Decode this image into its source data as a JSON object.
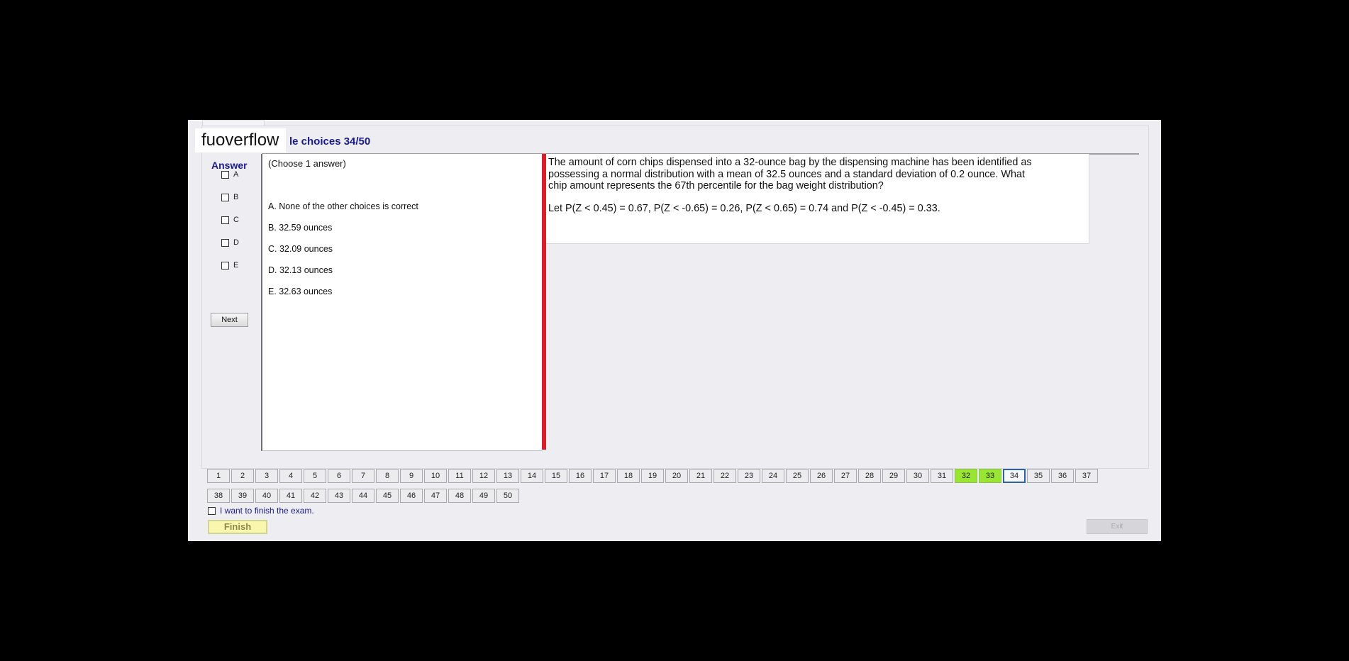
{
  "brand": "fuoverflow",
  "section_title": "le choices 34/50",
  "answer_heading": "Answer",
  "answer_options": [
    "A",
    "B",
    "C",
    "D",
    "E"
  ],
  "next_label": "Next",
  "choose_hint": "(Choose 1 answer)",
  "choices": [
    "A.  None of the other choices is correct",
    "B.  32.59 ounces",
    "C.  32.09 ounces",
    "D.  32.13 ounces",
    "E.  32.63 ounces"
  ],
  "question": {
    "text": "The amount of corn chips dispensed into a 32-ounce bag by the dispensing machine has been identified as possessing a normal distribution with a mean of 32.5 ounces and a standard deviation of 0.2 ounce. What chip amount represents the 67th percentile for the bag weight distribution?",
    "hint": "Let P(Z < 0.45) = 0.67, P(Z < -0.65) = 0.26, P(Z < 0.65) = 0.74 and P(Z < -0.45) = 0.33."
  },
  "question_nav": {
    "row1": [
      "1",
      "2",
      "3",
      "4",
      "5",
      "6",
      "7",
      "8",
      "9",
      "10",
      "11",
      "12",
      "13",
      "14",
      "15",
      "16",
      "17",
      "18",
      "19",
      "20",
      "21",
      "22",
      "23",
      "24",
      "25",
      "26",
      "27",
      "28",
      "29",
      "30",
      "31",
      "32",
      "33",
      "34",
      "35",
      "36",
      "37"
    ],
    "row2": [
      "38",
      "39",
      "40",
      "41",
      "42",
      "43",
      "44",
      "45",
      "46",
      "47",
      "48",
      "49",
      "50"
    ],
    "answered": [
      "32",
      "33"
    ],
    "current": "34",
    "answered_color": "#99e632",
    "current_border_color": "#2e62a8"
  },
  "finish_checkbox_label": "I want to finish the exam.",
  "finish_label": "Finish",
  "exit_label": "Exit"
}
